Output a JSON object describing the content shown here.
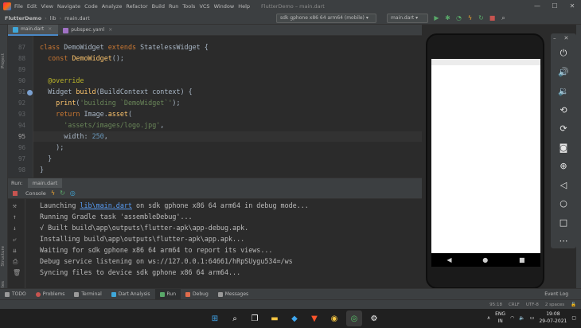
{
  "window": {
    "app_name": "FlutterDemo",
    "title": "FlutterDemo – main.dart",
    "menu": [
      "File",
      "Edit",
      "View",
      "Navigate",
      "Code",
      "Analyze",
      "Refactor",
      "Build",
      "Run",
      "Tools",
      "VCS",
      "Window",
      "Help"
    ],
    "controls": {
      "minimize": "—",
      "maximize": "☐",
      "close": "✕"
    }
  },
  "navbar": {
    "project": "FlutterDemo",
    "folder": "lib",
    "file": "main.dart",
    "device": "sdk gphone x86 64 arm64 (mobile)",
    "run_config": "main.dart",
    "toolbar_icons": [
      "run-icon",
      "debug-icon",
      "profile-icon",
      "hot-reload-icon",
      "hot-restart-icon",
      "stop-icon",
      "search-icon"
    ]
  },
  "left_strip": {
    "project_label": "Project",
    "structure_label": "Structure",
    "favorites_label": "Favorites"
  },
  "editor": {
    "tabs": [
      {
        "label": "main.dart",
        "close": "×",
        "active": true
      },
      {
        "label": "pubspec.yaml",
        "close": "×",
        "active": false
      }
    ],
    "line_numbers": [
      "87",
      "88",
      "89",
      "90",
      "91",
      "92",
      "93",
      "94",
      "95",
      "96",
      "97",
      "98"
    ],
    "current_line": "95"
  },
  "run_panel": {
    "label": "Run:",
    "run_tab": "main.dart",
    "console_tab": "Console",
    "console_link": "lib\\main.dart",
    "console_lines": [
      "Launching ",
      " on sdk gphone x86 64 arm64 in debug mode...",
      "Running Gradle task 'assembleDebug'...",
      "√ Built build\\app\\outputs\\flutter-apk\\app-debug.apk.",
      "Installing build\\app\\outputs\\flutter-apk\\app.apk...",
      "Waiting for sdk gphone x86 64 arm64 to report its views...",
      "Debug service listening on ws://127.0.0.1:64661/hRpSUygu534=/ws",
      "Syncing files to device sdk gphone x86 64 arm64..."
    ]
  },
  "emulator": {
    "controls": [
      "power-icon",
      "volume-up-icon",
      "volume-down-icon",
      "rotate-left-icon",
      "rotate-right-icon",
      "camera-icon",
      "zoom-icon",
      "back-icon",
      "home-icon",
      "overview-icon",
      "more-icon"
    ],
    "nav": [
      "◀",
      "●",
      "■"
    ]
  },
  "tool_tabs": [
    {
      "label": "TODO",
      "color": "#9a9a9a"
    },
    {
      "label": "Problems",
      "color": "#c75450"
    },
    {
      "label": "Terminal",
      "color": "#9a9a9a"
    },
    {
      "label": "Dart Analysis",
      "color": "#3fa7d9"
    },
    {
      "label": "Run",
      "color": "#59a869",
      "active": true
    },
    {
      "label": "Debug",
      "color": "#e06c4c"
    },
    {
      "label": "Messages",
      "color": "#9a9a9a"
    }
  ],
  "event_log": "Event Log",
  "status": {
    "position": "95:18",
    "line_sep": "CRLF",
    "encoding": "UTF-8",
    "indent": "2 spaces"
  },
  "taskbar": {
    "lang_top": "ENG",
    "lang_bottom": "IN",
    "time": "19:08",
    "date": "29-07-2021"
  }
}
